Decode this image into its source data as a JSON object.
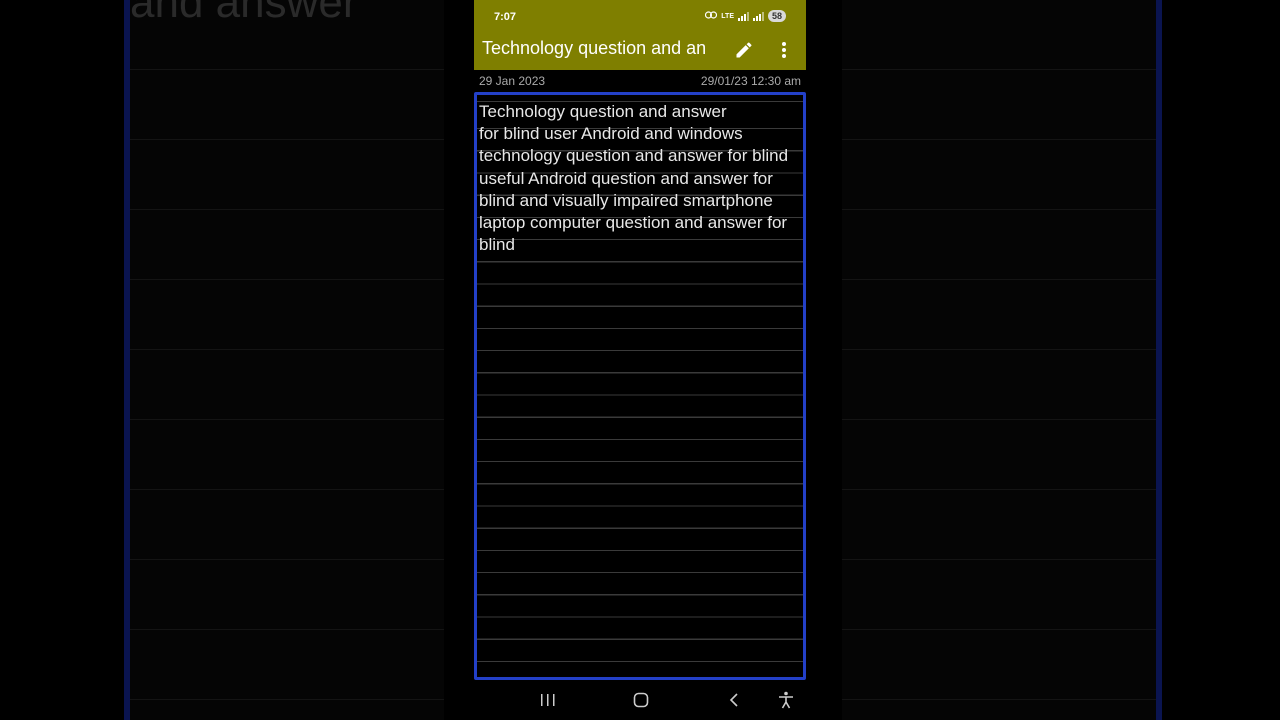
{
  "status_bar": {
    "time": "7:07",
    "battery": "58",
    "network": "LTE"
  },
  "toolbar": {
    "title": "Technology question and an",
    "edit_icon": "pencil-icon",
    "menu_icon": "more-vert-icon"
  },
  "note": {
    "date": "29 Jan 2023",
    "modified": "29/01/23 12:30 am",
    "body": "Technology question and answer\nfor blind user Android and windows technology question and answer for blind useful Android question and answer for blind and visually impaired smartphone laptop computer question and answer for blind"
  },
  "background": {
    "ghost_text": "and answer"
  },
  "nav": {
    "recents_icon": "recents-icon",
    "home_icon": "home-icon",
    "back_icon": "back-icon",
    "accessibility_icon": "accessibility-icon"
  },
  "colors": {
    "header": "#7f7f00",
    "note_border": "#2340c8",
    "background": "#000000"
  }
}
